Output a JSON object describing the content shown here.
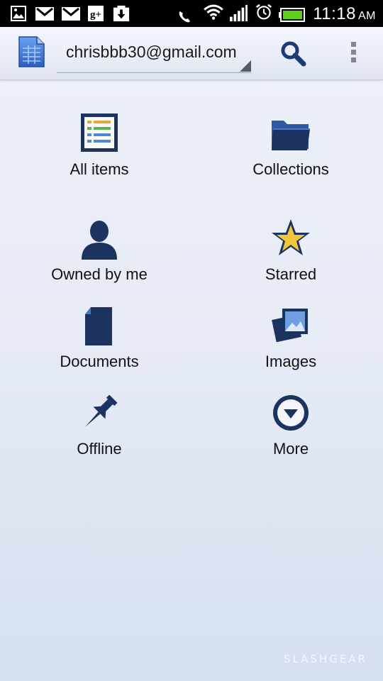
{
  "status_bar": {
    "time": "11:18",
    "ampm": "AM",
    "icons": [
      "gallery-icon",
      "gmail-icon",
      "gmail-icon",
      "google-plus-icon",
      "download-icon",
      "phone-icon",
      "wifi-icon",
      "signal-icon",
      "alarm-icon",
      "battery-icon"
    ]
  },
  "action_bar": {
    "account": "chrisbbb30@gmail.com",
    "app_icon": "drive-logo-icon",
    "search_icon": "search-icon",
    "overflow_icon": "overflow-menu-icon"
  },
  "menu": {
    "items": [
      {
        "label": "All items",
        "icon": "list-icon"
      },
      {
        "label": "Collections",
        "icon": "folder-icon"
      },
      {
        "label": "Owned by me",
        "icon": "person-icon"
      },
      {
        "label": "Starred",
        "icon": "star-icon"
      },
      {
        "label": "Documents",
        "icon": "document-icon"
      },
      {
        "label": "Images",
        "icon": "images-icon"
      },
      {
        "label": "Offline",
        "icon": "pin-icon"
      },
      {
        "label": "More",
        "icon": "chevron-down-circle-icon"
      }
    ]
  },
  "watermark": "SLASHGEAR"
}
